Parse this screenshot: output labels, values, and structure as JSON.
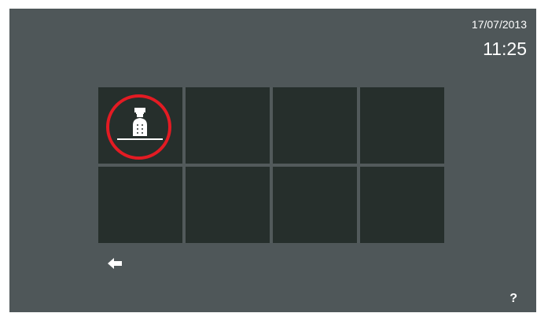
{
  "status": {
    "date": "17/07/2013",
    "time": "11:25"
  },
  "grid": {
    "cells": [
      {
        "icon": "concierge-icon",
        "selected": true
      },
      {
        "icon": null
      },
      {
        "icon": null
      },
      {
        "icon": null
      },
      {
        "icon": null
      },
      {
        "icon": null
      },
      {
        "icon": null
      },
      {
        "icon": null
      }
    ]
  },
  "nav": {
    "back_icon": "back-arrow-icon",
    "help_label": "?"
  },
  "colors": {
    "background": "#4f5759",
    "tile": "#262f2c",
    "highlight": "#e31b23",
    "foreground": "#ffffff"
  }
}
